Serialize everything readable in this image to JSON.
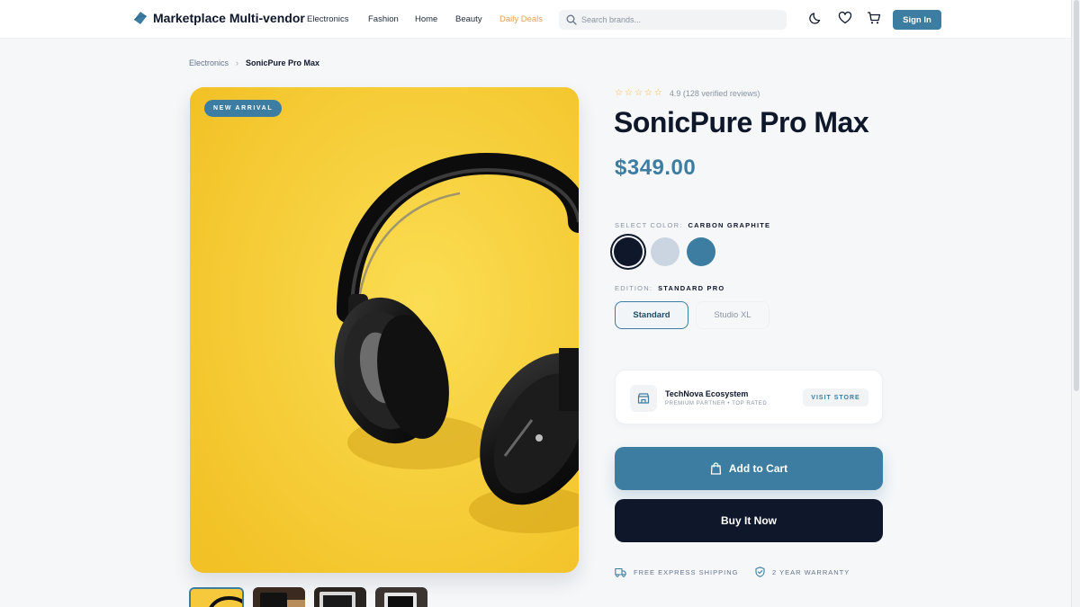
{
  "header": {
    "brand": "Marketplace Multi-vendor",
    "nav": [
      {
        "label": "Electronics"
      },
      {
        "label": "Fashion"
      },
      {
        "label": "Home"
      },
      {
        "label": "Beauty"
      },
      {
        "label": "Daily Deals"
      }
    ],
    "search_placeholder": "Search brands...",
    "icons": [
      "moon-icon",
      "heart-icon",
      "cart-icon"
    ],
    "signin_label": "Sign In"
  },
  "breadcrumb": {
    "parent": "Electronics",
    "current": "SonicPure Pro Max"
  },
  "gallery": {
    "badge": "NEW ARRIVAL",
    "thumbnail_count": 4,
    "active_thumbnail": 1
  },
  "product": {
    "rating_stars": 5,
    "rating_text": "4.9 (128 verified reviews)",
    "title": "SonicPure Pro Max",
    "price": "$349.00",
    "color_label": "SELECT COLOR:",
    "color_value": "CARBON GRAPHITE",
    "colors": [
      "#0f172a",
      "#cbd5e1",
      "#3c7da1"
    ],
    "selected_color": 0,
    "edition_label": "EDITION:",
    "edition_value": "STANDARD PRO",
    "editions": [
      "Standard",
      "Studio XL"
    ],
    "selected_edition": 0
  },
  "store": {
    "name": "TechNova Ecosystem",
    "subtitle": "PREMIUM PARTNER • TOP RATED",
    "visit_label": "VISIT STORE"
  },
  "actions": {
    "add_to_cart": "Add to Cart",
    "buy_now": "Buy It Now"
  },
  "perks": {
    "shipping": "FREE EXPRESS SHIPPING",
    "warranty": "2 YEAR WARRANTY"
  },
  "colors": {
    "accent": "#3c7da1",
    "dark": "#0f172a",
    "deals": "#e5a157",
    "hero_bg": "#f6c93d"
  }
}
